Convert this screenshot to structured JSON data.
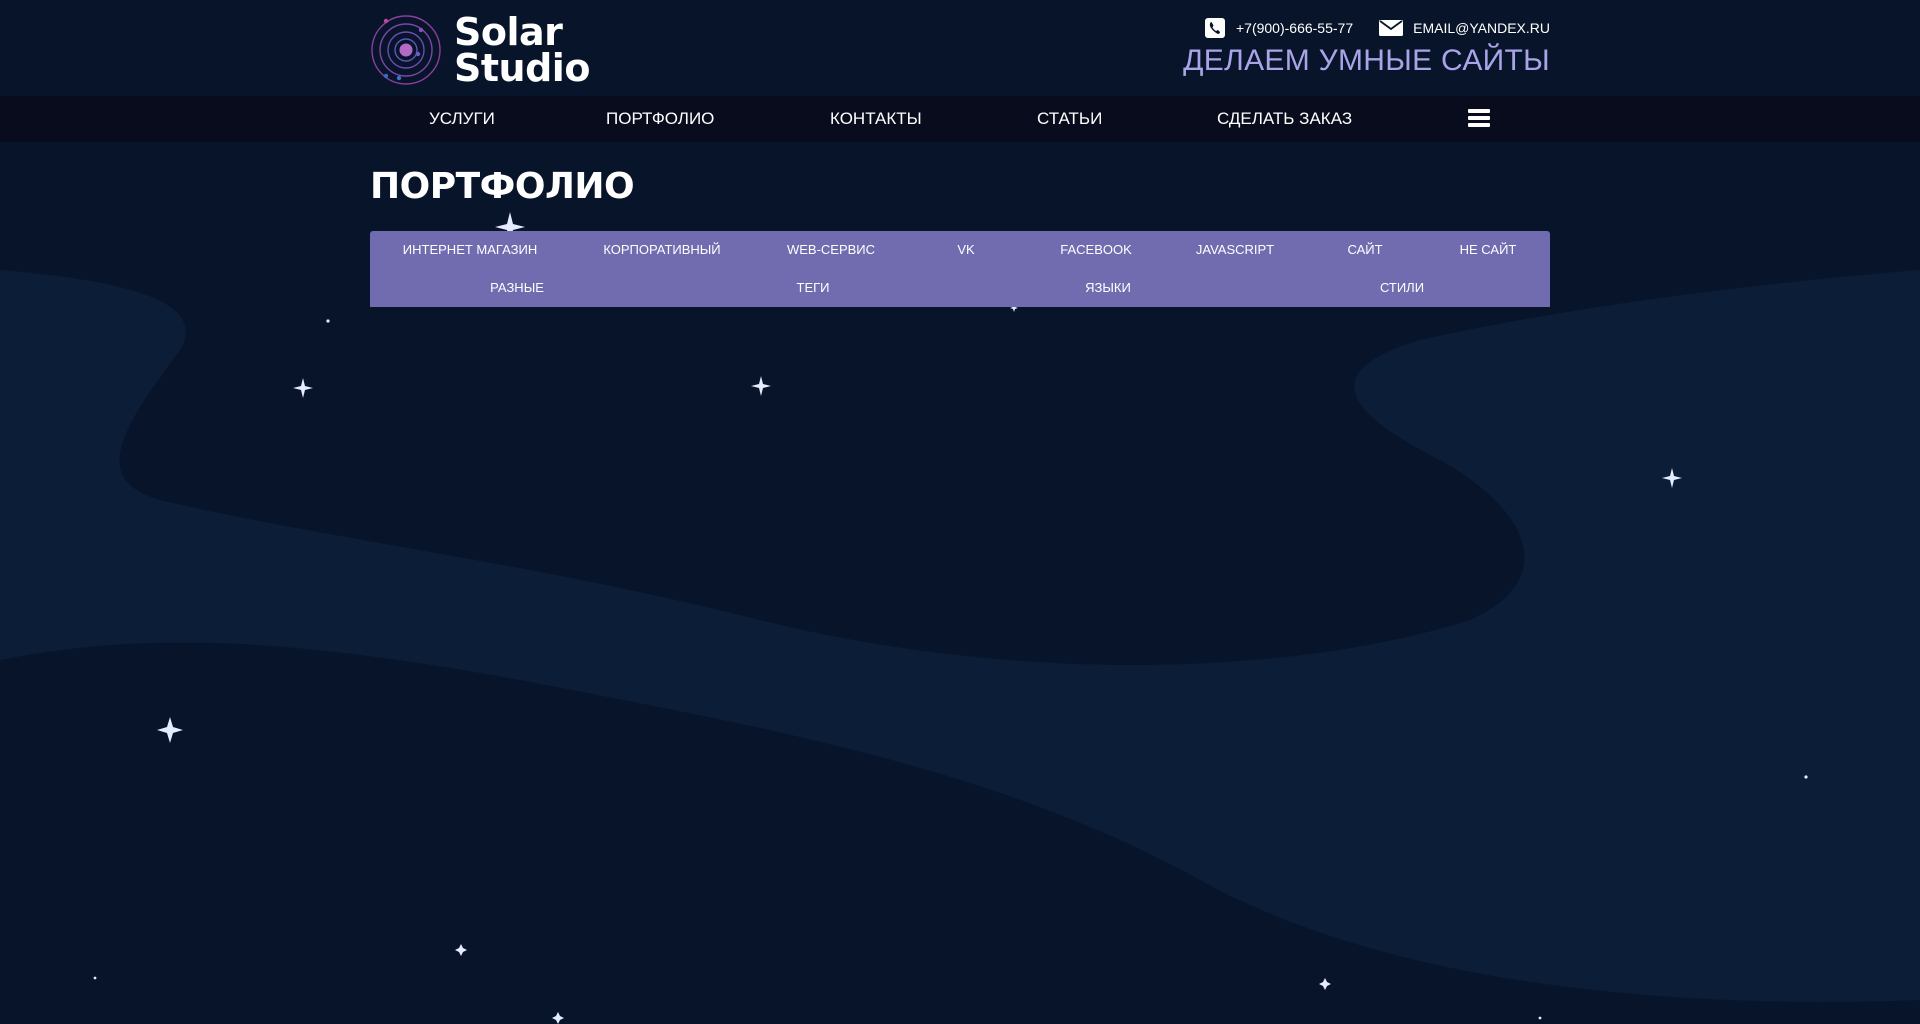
{
  "brand": {
    "name_line1": "Solar",
    "name_line2": "Studio",
    "logo_icon": "orbit-logo-icon"
  },
  "contacts": {
    "phone": "+7(900)-666-55-77",
    "phone_icon": "phone-icon",
    "email": "EMAIL@YANDEX.RU",
    "email_icon": "envelope-icon"
  },
  "tagline": "ДЕЛАЕМ УМНЫЕ САЙТЫ",
  "nav": {
    "items": [
      "УСЛУГИ",
      "ПОРТФОЛИО",
      "КОНТАКТЫ",
      "СТАТЬИ",
      "СДЕЛАТЬ ЗАКАЗ"
    ],
    "menu_icon": "hamburger-menu-icon"
  },
  "page": {
    "title": "ПОРТФОЛИО"
  },
  "filters": {
    "row1": [
      "ИНТЕРНЕТ МАГАЗИН",
      "КОРПОРАТИВНЫЙ",
      "WEB-СЕРВИС",
      "VK",
      "FACEBOOK",
      "JAVASCRIPT",
      "САЙТ",
      "НЕ САЙТ"
    ],
    "row2": [
      "РАЗНЫЕ",
      "ТЕГИ",
      "ЯЗЫКИ",
      "СТИЛИ"
    ]
  },
  "colors": {
    "background": "#081429",
    "nav_background": "#090c1c",
    "tagline": "#a9a4e8",
    "filter_panel": "#716cb0",
    "wave": "#0c1d38"
  }
}
